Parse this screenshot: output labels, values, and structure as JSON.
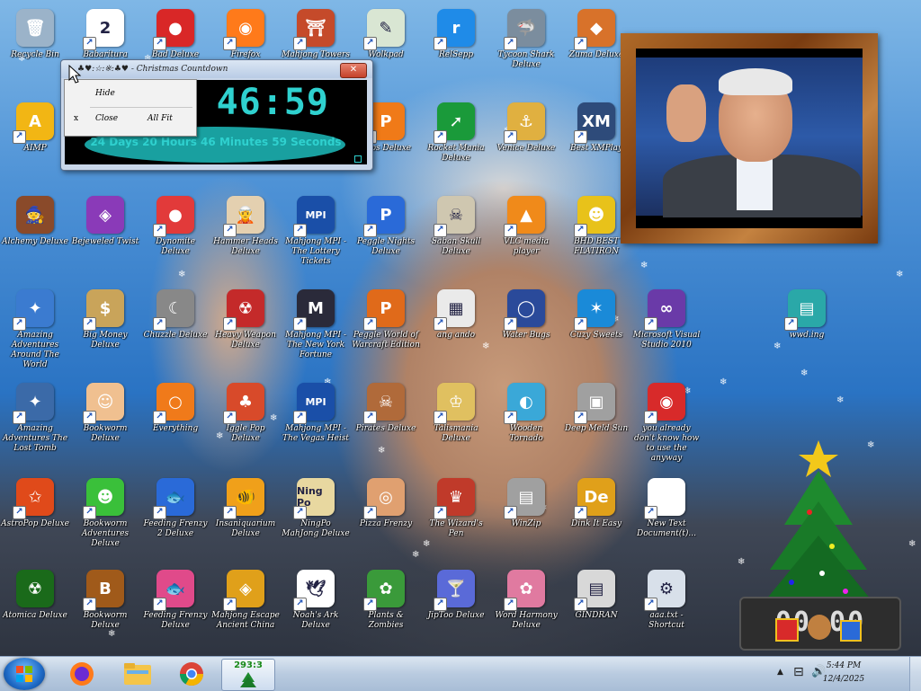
{
  "desktop": {
    "icons": [
      {
        "label": "Recycle Bin",
        "color": "#9bb3c9",
        "glyph": "🗑",
        "shortcut": false
      },
      {
        "label": "Babaritura",
        "color": "#ffffff",
        "glyph": "2",
        "shortcut": true
      },
      {
        "label": "Bad Deluxe",
        "color": "#d92727",
        "glyph": "●",
        "shortcut": true
      },
      {
        "label": "Firefox",
        "color": "#ff7a1a",
        "glyph": "◉",
        "shortcut": true
      },
      {
        "label": "Mahjong Towers",
        "color": "#c54a2a",
        "glyph": "⛩",
        "shortcut": true
      },
      {
        "label": "Wolkpad",
        "color": "#d9e6d3",
        "glyph": "✎",
        "shortcut": true
      },
      {
        "label": "RelSepp",
        "color": "#1f8be8",
        "glyph": "r",
        "shortcut": true
      },
      {
        "label": "Tycoon Shark Deluxe",
        "color": "#7b8d9e",
        "glyph": "🦈",
        "shortcut": true
      },
      {
        "label": "Zuma Deluxe",
        "color": "#d8722a",
        "glyph": "◆",
        "shortcut": true
      },
      {
        "label": "AIMP",
        "color": "#f2b614",
        "glyph": "A",
        "shortcut": true
      },
      {
        "label": "Pops Deluxe",
        "color": "#f07a18",
        "glyph": "P",
        "shortcut": true
      },
      {
        "label": "Rocket Mania Deluxe",
        "color": "#1a9a3a",
        "glyph": "➚",
        "shortcut": true
      },
      {
        "label": "Venice Deluxe",
        "color": "#e0b040",
        "glyph": "⚓",
        "shortcut": true
      },
      {
        "label": "Best XMPlay",
        "color": "#2e4b7a",
        "glyph": "XM",
        "shortcut": true
      },
      {
        "label": "Alchemy Deluxe",
        "color": "#8a4a2a",
        "glyph": "🧙",
        "shortcut": false
      },
      {
        "label": "Bejeweled Twist",
        "color": "#8a3ab8",
        "glyph": "◈",
        "shortcut": false
      },
      {
        "label": "Dynomite Deluxe",
        "color": "#e23a3a",
        "glyph": "●",
        "shortcut": true
      },
      {
        "label": "Hammer Heads Deluxe",
        "color": "#e4d0b0",
        "glyph": "🧝",
        "shortcut": true
      },
      {
        "label": "Mahjong MPI - The Lottery Tickets",
        "color": "#1a4fa8",
        "glyph": "MPI",
        "shortcut": true
      },
      {
        "label": "Peggle Nights Deluxe",
        "color": "#2a6ad8",
        "glyph": "P",
        "shortcut": true
      },
      {
        "label": "Saban Skull Deluxe",
        "color": "#cfc7b0",
        "glyph": "☠",
        "shortcut": true
      },
      {
        "label": "VLC media player",
        "color": "#f08a1a",
        "glyph": "▲",
        "shortcut": true
      },
      {
        "label": "BHD BEST FLATIRON",
        "color": "#e8c21a",
        "glyph": "☻",
        "shortcut": true
      },
      {
        "label": "Amazing Adventures Around The World",
        "color": "#3b7bd0",
        "glyph": "✦",
        "shortcut": true
      },
      {
        "label": "Big Money Deluxe",
        "color": "#c9a45a",
        "glyph": "$",
        "shortcut": true
      },
      {
        "label": "Chuzzle Deluxe",
        "color": "#888",
        "glyph": "☾",
        "shortcut": true
      },
      {
        "label": "Heavy Weapon Deluxe",
        "color": "#c42a2a",
        "glyph": "☢",
        "shortcut": true
      },
      {
        "label": "Mahjong MPI - The New York Fortune",
        "color": "#2a2a3a",
        "glyph": "M",
        "shortcut": true
      },
      {
        "label": "Peggle World of Warcraft Edition",
        "color": "#e06a1a",
        "glyph": "P",
        "shortcut": true
      },
      {
        "label": "ang ando",
        "color": "#eaeaea",
        "glyph": "▦",
        "shortcut": true
      },
      {
        "label": "Water Bugs",
        "color": "#2a4a9a",
        "glyph": "◯",
        "shortcut": true
      },
      {
        "label": "Cuzy Sweets",
        "color": "#1a8ad8",
        "glyph": "✶",
        "shortcut": true
      },
      {
        "label": "Microsoft Visual Studio 2010",
        "color": "#6a3aa8",
        "glyph": "∞",
        "shortcut": true
      },
      {
        "label": "wwd.ing",
        "color": "#2aa8a8",
        "glyph": "▤",
        "shortcut": true
      },
      {
        "label": "Amazing Adventures The Lost Tomb",
        "color": "#3b6aa8",
        "glyph": "✦",
        "shortcut": true
      },
      {
        "label": "Bookworm Deluxe",
        "color": "#f0c090",
        "glyph": "☺",
        "shortcut": true
      },
      {
        "label": "Everything",
        "color": "#f07a1a",
        "glyph": "○",
        "shortcut": true
      },
      {
        "label": "Iggle Pop Deluxe",
        "color": "#d84a2a",
        "glyph": "♣",
        "shortcut": true
      },
      {
        "label": "Mahjong MPI - The Vegas Heist",
        "color": "#1a4fa8",
        "glyph": "MPI",
        "shortcut": true
      },
      {
        "label": "Pirates Deluxe",
        "color": "#b06a3a",
        "glyph": "☠",
        "shortcut": true
      },
      {
        "label": "Talismania Deluxe",
        "color": "#e0c060",
        "glyph": "♔",
        "shortcut": true
      },
      {
        "label": "Wooden Tornado",
        "color": "#3aa8d8",
        "glyph": "◐",
        "shortcut": true
      },
      {
        "label": "Deep Meld Sun",
        "color": "#a0a0a0",
        "glyph": "▣",
        "shortcut": true
      },
      {
        "label": "you already don't know how to use the anyway",
        "color": "#d82a2a",
        "glyph": "◉",
        "shortcut": true
      },
      {
        "label": "AstroPop Deluxe",
        "color": "#e04a1a",
        "glyph": "✩",
        "shortcut": true
      },
      {
        "label": "Bookworm Adventures Deluxe",
        "color": "#3ac03a",
        "glyph": "☻",
        "shortcut": true
      },
      {
        "label": "Feeding Frenzy 2 Deluxe",
        "color": "#2a6ad8",
        "glyph": "🐟",
        "shortcut": true
      },
      {
        "label": "Insaniquarium Deluxe",
        "color": "#f0a01a",
        "glyph": "🐠",
        "shortcut": true
      },
      {
        "label": "NingPo MahJong Deluxe",
        "color": "#e8d8a0",
        "glyph": "Ning Po",
        "shortcut": true
      },
      {
        "label": "Pizza Frenzy",
        "color": "#e0a070",
        "glyph": "◎",
        "shortcut": true
      },
      {
        "label": "The Wizard's Pen",
        "color": "#c03a2a",
        "glyph": "♛",
        "shortcut": true
      },
      {
        "label": "WinZip",
        "color": "#a0a0a0",
        "glyph": "▤",
        "shortcut": true
      },
      {
        "label": "Dink It Easy",
        "color": "#e0a01a",
        "glyph": "De",
        "shortcut": true
      },
      {
        "label": "New Text Document(t)...",
        "color": "#ffffff",
        "glyph": "",
        "shortcut": true
      },
      {
        "label": "Atomica Deluxe",
        "color": "#1a6a1a",
        "glyph": "☢",
        "shortcut": false
      },
      {
        "label": "Bookworm Deluxe",
        "color": "#a05a1a",
        "glyph": "B",
        "shortcut": true
      },
      {
        "label": "Feeding Frenzy Deluxe",
        "color": "#e04a8a",
        "glyph": "🐟",
        "shortcut": true
      },
      {
        "label": "Mahjong Escape Ancient China",
        "color": "#e0a01a",
        "glyph": "◈",
        "shortcut": true
      },
      {
        "label": "Noah's Ark Deluxe",
        "color": "#ffffff",
        "glyph": "🕊",
        "shortcut": true
      },
      {
        "label": "Plants & Zombies",
        "color": "#3a9a3a",
        "glyph": "✿",
        "shortcut": true
      },
      {
        "label": "JipToo Deluxe",
        "color": "#5a6ad8",
        "glyph": "🍸",
        "shortcut": true
      },
      {
        "label": "Word Harmony Deluxe",
        "color": "#e07aa0",
        "glyph": "✿",
        "shortcut": true
      },
      {
        "label": "GINDRAN",
        "color": "#d8d8d8",
        "glyph": "▤",
        "shortcut": true
      },
      {
        "label": "aaa.txt - Shortcut",
        "color": "#d8e0ea",
        "glyph": "⚙",
        "shortcut": true
      }
    ]
  },
  "countdown": {
    "title": "♣♥:☆:※:♣♥ - Christmas Countdown",
    "close_glyph": "✕",
    "time": "46:59",
    "long_text": "24 Days 20 Hours 46 Minutes 59 Seconds",
    "menu": {
      "item1": "Hide",
      "x_mark": "x",
      "item2": "Close",
      "item3": "All Fit"
    }
  },
  "tree": {
    "clock": "00:00"
  },
  "taskbar": {
    "countdown_label": "293:3",
    "tray_time": "5:44 PM",
    "tray_date": "12/4/2025",
    "tray_flag": "▲",
    "tray_net": "⊟",
    "tray_vol": "🔊"
  },
  "colors": {
    "clock_cyan": "#2fd1cf",
    "accent_teal": "#19a0a0",
    "taskbar_top": "#dbe6f1"
  }
}
